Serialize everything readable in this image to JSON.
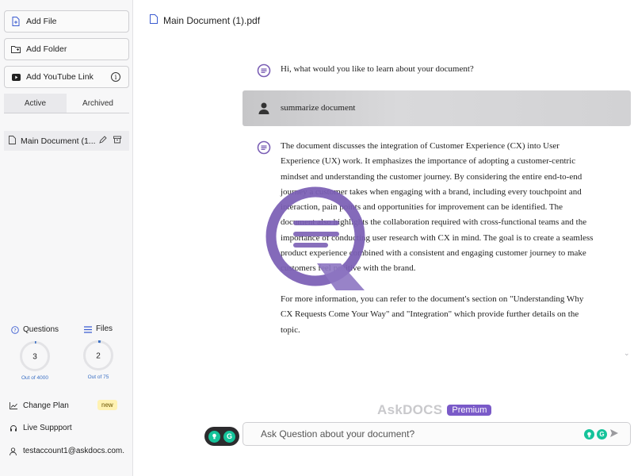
{
  "sidebar": {
    "add_file": "Add File",
    "add_folder": "Add Folder",
    "add_youtube": "Add YouTube Link",
    "tabs": [
      {
        "label": "Active",
        "active": true
      },
      {
        "label": "Archived",
        "active": false
      }
    ],
    "documents": [
      {
        "label": "Main Document (1..."
      }
    ],
    "usage": {
      "questions": {
        "label": "Questions",
        "value": "3",
        "limit": "Out of 4000",
        "fraction": 0.00075
      },
      "files": {
        "label": "Files",
        "value": "2",
        "limit": "Out of 75",
        "fraction": 0.027
      }
    },
    "change_plan": "Change Plan",
    "new_badge": "new",
    "live_support": "Live Suppport",
    "account": "testaccount1@askdocs.com."
  },
  "main": {
    "doc_title": "Main Document (1).pdf",
    "messages": [
      {
        "role": "assistant",
        "lines": [
          "Hi, what would you like to learn about your document?"
        ]
      },
      {
        "role": "user",
        "lines": [
          "summarize document"
        ]
      },
      {
        "role": "assistant",
        "lines": [
          "The document discusses the integration of Customer Experience (CX) into User",
          "Experience (UX) work. It emphasizes the importance of adopting a customer-centric",
          "mindset and understanding the customer journey. By considering the entire end-to-end",
          "journey a customer takes when engaging with a brand, including every touchpoint and",
          "interaction, pain points and opportunities for improvement can be identified. The",
          "document also highlights the collaboration required with cross-functional teams and the",
          "importance of conducting user research with CX in mind. The goal is to create a seamless",
          "product experience combined with a consistent and engaging customer journey to make",
          "customers feel positive with the brand.",
          "",
          "For more information, you can refer to the document's section on \"Understanding Why",
          "CX Requests Come Your Way\" and \"Integration\" which provide further details on the",
          "topic."
        ]
      }
    ],
    "brand_name": "AskDOCS",
    "premium_label": "Premium",
    "input_placeholder": "Ask Question about your document?"
  },
  "colors": {
    "accent": "#7a5ac8",
    "logo": "#7b5fb5",
    "usage_text": "#3a6fc4",
    "grammarly_green": "#15c39a",
    "new_badge_bg": "#fff2b3"
  }
}
